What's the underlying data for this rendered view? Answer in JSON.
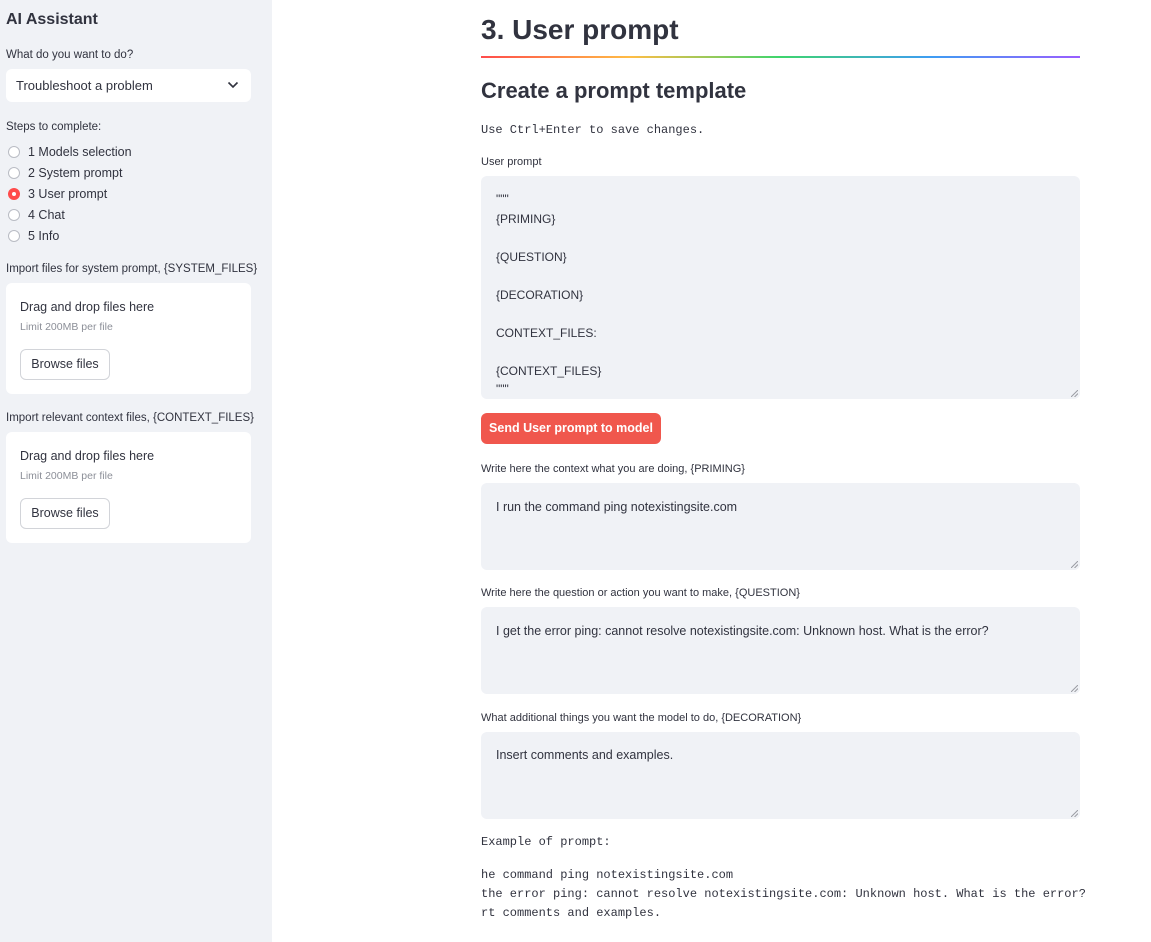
{
  "sidebar": {
    "title": "AI Assistant",
    "task_label": "What do you want to do?",
    "task_value": "Troubleshoot a problem",
    "steps_label": "Steps to complete:",
    "steps": [
      {
        "label": "1 Models selection",
        "selected": false
      },
      {
        "label": "2 System prompt",
        "selected": false
      },
      {
        "label": "3 User prompt",
        "selected": true
      },
      {
        "label": "4 Chat",
        "selected": false
      },
      {
        "label": "5 Info",
        "selected": false
      }
    ],
    "system_files": {
      "label": "Import files for system prompt, {SYSTEM_FILES}",
      "drop_text": "Drag and drop files here",
      "limit": "Limit 200MB per file",
      "button": "Browse files"
    },
    "context_files": {
      "label": "Import relevant context files, {CONTEXT_FILES}",
      "drop_text": "Drag and drop files here",
      "limit": "Limit 200MB per file",
      "button": "Browse files"
    }
  },
  "main": {
    "title": "3. User prompt",
    "subtitle": "Create a prompt template",
    "hint": "Use Ctrl+Enter to save changes.",
    "user_prompt": {
      "label": "User prompt",
      "lines": [
        "\"\"\"",
        "{PRIMING}",
        "",
        "{QUESTION}",
        "",
        "{DECORATION}",
        "",
        "CONTEXT_FILES:",
        "",
        "{CONTEXT_FILES}",
        "\"\"\""
      ]
    },
    "send_button": "Send User prompt to model",
    "priming": {
      "label": "Write here the context what you are doing, {PRIMING}",
      "value": "I run the command ping notexistingsite.com"
    },
    "question": {
      "label": "Write here the question or action you want to make, {QUESTION}",
      "value": "I get the error ping: cannot resolve notexistingsite.com: Unknown host. What is the error?"
    },
    "decoration": {
      "label": "What additional things you want the model to do, {DECORATION}",
      "value": "Insert comments and examples."
    },
    "example_label": "Example of prompt:",
    "example_lines": [
      "he command ping notexistingsite.com",
      "the error ping: cannot resolve notexistingsite.com: Unknown host. What is the error?",
      "rt comments and examples."
    ]
  },
  "colors": {
    "accent": "#ff4b4b",
    "button": "#f0574d",
    "sidebar_bg": "#f0f2f6",
    "text": "#31333f"
  }
}
